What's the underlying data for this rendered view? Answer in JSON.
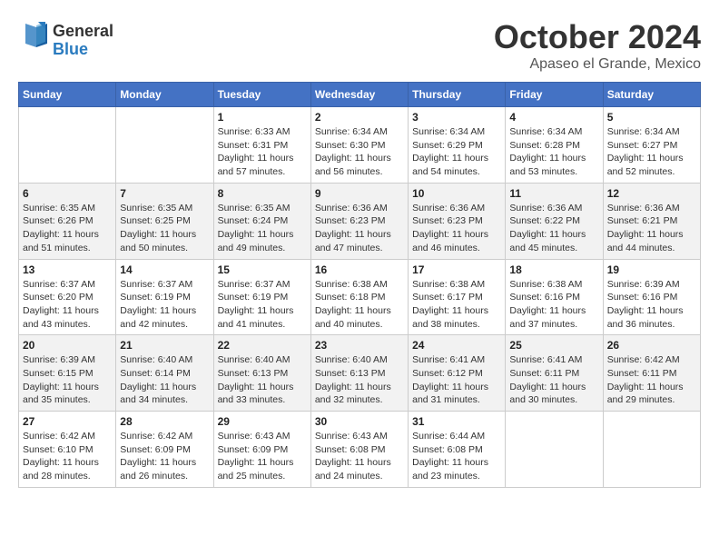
{
  "header": {
    "logo": {
      "general": "General",
      "blue": "Blue"
    },
    "month_title": "October 2024",
    "location": "Apaseo el Grande, Mexico"
  },
  "weekdays": [
    "Sunday",
    "Monday",
    "Tuesday",
    "Wednesday",
    "Thursday",
    "Friday",
    "Saturday"
  ],
  "weeks": [
    [
      {
        "day": "",
        "info": ""
      },
      {
        "day": "",
        "info": ""
      },
      {
        "day": "1",
        "info": "Sunrise: 6:33 AM\nSunset: 6:31 PM\nDaylight: 11 hours and 57 minutes."
      },
      {
        "day": "2",
        "info": "Sunrise: 6:34 AM\nSunset: 6:30 PM\nDaylight: 11 hours and 56 minutes."
      },
      {
        "day": "3",
        "info": "Sunrise: 6:34 AM\nSunset: 6:29 PM\nDaylight: 11 hours and 54 minutes."
      },
      {
        "day": "4",
        "info": "Sunrise: 6:34 AM\nSunset: 6:28 PM\nDaylight: 11 hours and 53 minutes."
      },
      {
        "day": "5",
        "info": "Sunrise: 6:34 AM\nSunset: 6:27 PM\nDaylight: 11 hours and 52 minutes."
      }
    ],
    [
      {
        "day": "6",
        "info": "Sunrise: 6:35 AM\nSunset: 6:26 PM\nDaylight: 11 hours and 51 minutes."
      },
      {
        "day": "7",
        "info": "Sunrise: 6:35 AM\nSunset: 6:25 PM\nDaylight: 11 hours and 50 minutes."
      },
      {
        "day": "8",
        "info": "Sunrise: 6:35 AM\nSunset: 6:24 PM\nDaylight: 11 hours and 49 minutes."
      },
      {
        "day": "9",
        "info": "Sunrise: 6:36 AM\nSunset: 6:23 PM\nDaylight: 11 hours and 47 minutes."
      },
      {
        "day": "10",
        "info": "Sunrise: 6:36 AM\nSunset: 6:23 PM\nDaylight: 11 hours and 46 minutes."
      },
      {
        "day": "11",
        "info": "Sunrise: 6:36 AM\nSunset: 6:22 PM\nDaylight: 11 hours and 45 minutes."
      },
      {
        "day": "12",
        "info": "Sunrise: 6:36 AM\nSunset: 6:21 PM\nDaylight: 11 hours and 44 minutes."
      }
    ],
    [
      {
        "day": "13",
        "info": "Sunrise: 6:37 AM\nSunset: 6:20 PM\nDaylight: 11 hours and 43 minutes."
      },
      {
        "day": "14",
        "info": "Sunrise: 6:37 AM\nSunset: 6:19 PM\nDaylight: 11 hours and 42 minutes."
      },
      {
        "day": "15",
        "info": "Sunrise: 6:37 AM\nSunset: 6:19 PM\nDaylight: 11 hours and 41 minutes."
      },
      {
        "day": "16",
        "info": "Sunrise: 6:38 AM\nSunset: 6:18 PM\nDaylight: 11 hours and 40 minutes."
      },
      {
        "day": "17",
        "info": "Sunrise: 6:38 AM\nSunset: 6:17 PM\nDaylight: 11 hours and 38 minutes."
      },
      {
        "day": "18",
        "info": "Sunrise: 6:38 AM\nSunset: 6:16 PM\nDaylight: 11 hours and 37 minutes."
      },
      {
        "day": "19",
        "info": "Sunrise: 6:39 AM\nSunset: 6:16 PM\nDaylight: 11 hours and 36 minutes."
      }
    ],
    [
      {
        "day": "20",
        "info": "Sunrise: 6:39 AM\nSunset: 6:15 PM\nDaylight: 11 hours and 35 minutes."
      },
      {
        "day": "21",
        "info": "Sunrise: 6:40 AM\nSunset: 6:14 PM\nDaylight: 11 hours and 34 minutes."
      },
      {
        "day": "22",
        "info": "Sunrise: 6:40 AM\nSunset: 6:13 PM\nDaylight: 11 hours and 33 minutes."
      },
      {
        "day": "23",
        "info": "Sunrise: 6:40 AM\nSunset: 6:13 PM\nDaylight: 11 hours and 32 minutes."
      },
      {
        "day": "24",
        "info": "Sunrise: 6:41 AM\nSunset: 6:12 PM\nDaylight: 11 hours and 31 minutes."
      },
      {
        "day": "25",
        "info": "Sunrise: 6:41 AM\nSunset: 6:11 PM\nDaylight: 11 hours and 30 minutes."
      },
      {
        "day": "26",
        "info": "Sunrise: 6:42 AM\nSunset: 6:11 PM\nDaylight: 11 hours and 29 minutes."
      }
    ],
    [
      {
        "day": "27",
        "info": "Sunrise: 6:42 AM\nSunset: 6:10 PM\nDaylight: 11 hours and 28 minutes."
      },
      {
        "day": "28",
        "info": "Sunrise: 6:42 AM\nSunset: 6:09 PM\nDaylight: 11 hours and 26 minutes."
      },
      {
        "day": "29",
        "info": "Sunrise: 6:43 AM\nSunset: 6:09 PM\nDaylight: 11 hours and 25 minutes."
      },
      {
        "day": "30",
        "info": "Sunrise: 6:43 AM\nSunset: 6:08 PM\nDaylight: 11 hours and 24 minutes."
      },
      {
        "day": "31",
        "info": "Sunrise: 6:44 AM\nSunset: 6:08 PM\nDaylight: 11 hours and 23 minutes."
      },
      {
        "day": "",
        "info": ""
      },
      {
        "day": "",
        "info": ""
      }
    ]
  ]
}
